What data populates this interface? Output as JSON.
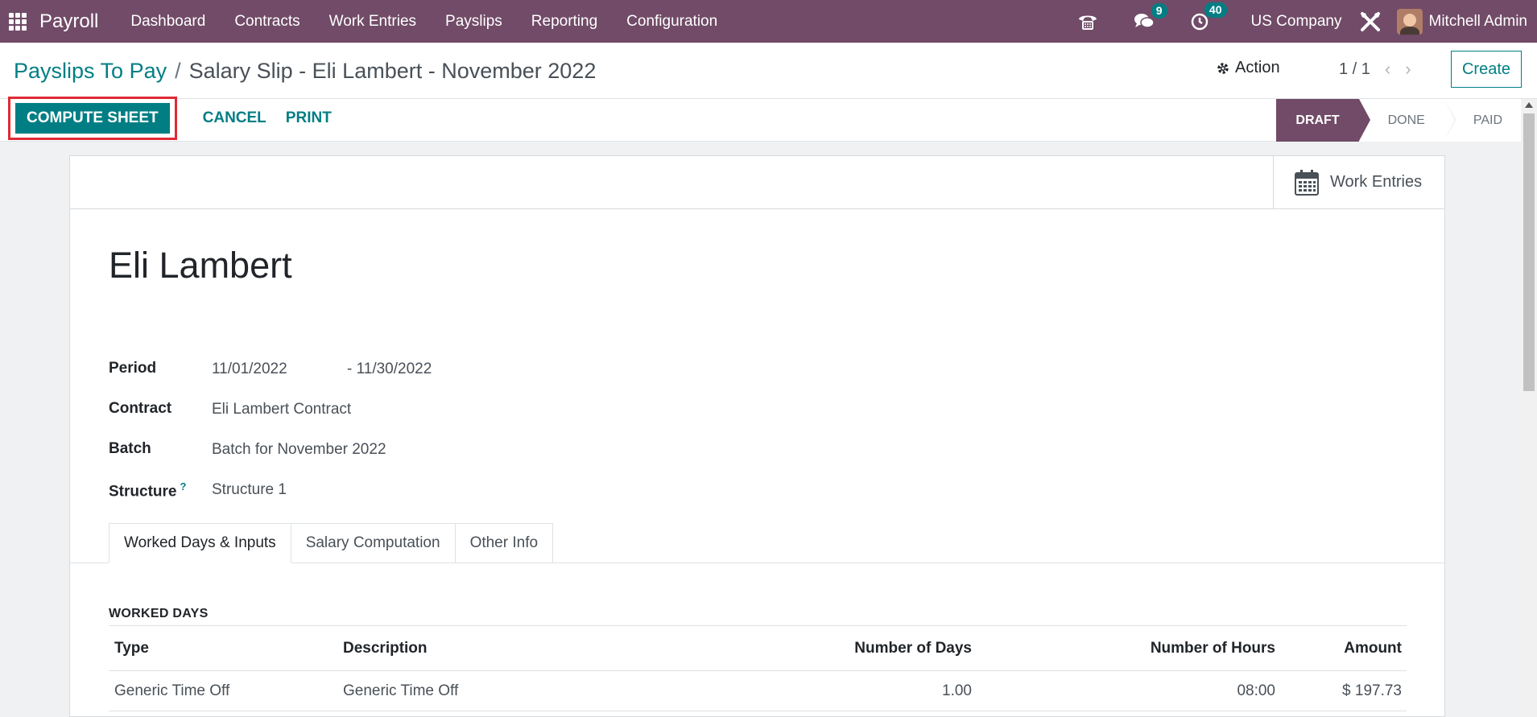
{
  "navbar": {
    "brand": "Payroll",
    "menu": [
      "Dashboard",
      "Contracts",
      "Work Entries",
      "Payslips",
      "Reporting",
      "Configuration"
    ],
    "messages_count": "9",
    "activities_count": "40",
    "company": "US Company",
    "user": "Mitchell Admin"
  },
  "breadcrumb": {
    "parent": "Payslips To Pay",
    "separator": "/",
    "current": "Salary Slip - Eli Lambert - November 2022"
  },
  "control": {
    "action_label": "Action",
    "pager": "1 / 1",
    "create_label": "Create"
  },
  "buttons": {
    "compute": "COMPUTE SHEET",
    "cancel": "CANCEL",
    "print": "PRINT"
  },
  "status": {
    "stages": [
      "DRAFT",
      "DONE",
      "PAID"
    ],
    "active": "DRAFT",
    "active_color": "#714b67"
  },
  "smart_button": {
    "work_entries": "Work Entries"
  },
  "form": {
    "employee": "Eli Lambert",
    "period_label": "Period",
    "period_start": "11/01/2022",
    "period_end": "- 11/30/2022",
    "contract_label": "Contract",
    "contract": "Eli Lambert Contract",
    "batch_label": "Batch",
    "batch": "Batch for November 2022",
    "structure_label": "Structure",
    "structure_help": "?",
    "structure": "Structure 1"
  },
  "tabs": [
    "Worked Days & Inputs",
    "Salary Computation",
    "Other Info"
  ],
  "worked_days": {
    "title": "WORKED DAYS",
    "columns": [
      "Type",
      "Description",
      "Number of Days",
      "Number of Hours",
      "Amount"
    ],
    "rows": [
      {
        "type": "Generic Time Off",
        "description": "Generic Time Off",
        "days": "1.00",
        "hours": "08:00",
        "amount": "$ 197.73"
      }
    ]
  },
  "colors": {
    "brand": "#714b67",
    "accent": "#017e84",
    "highlight": "#e02a35"
  }
}
